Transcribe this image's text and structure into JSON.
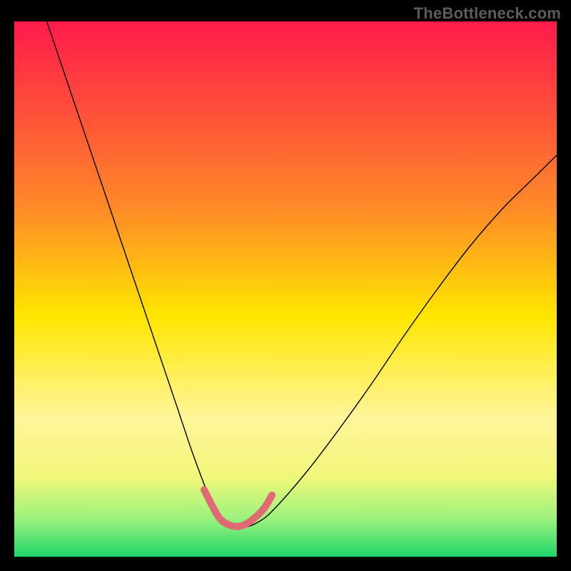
{
  "watermark": "TheBottleneck.com",
  "chart_data": {
    "type": "line",
    "title": "",
    "xlabel": "",
    "ylabel": "",
    "xlim": [
      0,
      100
    ],
    "ylim": [
      0,
      100
    ],
    "grid": false,
    "legend": false,
    "background_gradient": {
      "stops": [
        {
          "offset": 0.0,
          "color": "#ff1a4b"
        },
        {
          "offset": 0.35,
          "color": "#ff8a28"
        },
        {
          "offset": 0.55,
          "color": "#ffe600"
        },
        {
          "offset": 0.74,
          "color": "#fff59a"
        },
        {
          "offset": 0.85,
          "color": "#f1f77a"
        },
        {
          "offset": 0.93,
          "color": "#9bf27d"
        },
        {
          "offset": 1.0,
          "color": "#1fd56b"
        }
      ]
    },
    "series": [
      {
        "name": "bottleneck-curve",
        "color": "#000000",
        "stroke_width": 1.4,
        "x": [
          6,
          9,
          12,
          15,
          18,
          21,
          24,
          27,
          30,
          33,
          36,
          37.5,
          39,
          42,
          45,
          48,
          54,
          60,
          66,
          72,
          78,
          84,
          90,
          96,
          100
        ],
        "y": [
          100,
          91,
          82,
          73,
          64,
          55,
          46,
          37,
          28,
          19,
          11,
          8,
          6.5,
          5.5,
          6.5,
          9,
          16,
          24,
          32.5,
          41.5,
          50,
          58,
          65,
          71,
          75
        ]
      },
      {
        "name": "optimal-band",
        "color": "#e06a73",
        "stroke_width": 10,
        "linecap": "round",
        "x": [
          35,
          36.5,
          38,
          40,
          42,
          44,
          46,
          47.5
        ],
        "y": [
          12.5,
          9.5,
          7,
          5.8,
          5.8,
          7,
          9,
          11.5
        ]
      }
    ]
  }
}
